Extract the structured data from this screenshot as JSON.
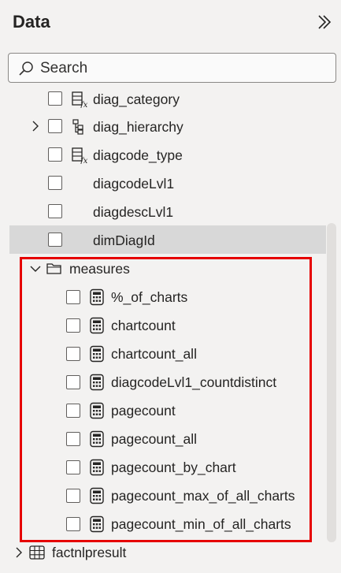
{
  "pane": {
    "title": "Data",
    "collapse_icon": "double-chevron-right-icon"
  },
  "search": {
    "placeholder": "Search",
    "icon": "search-icon"
  },
  "fields": [
    {
      "label": "diag_category",
      "icon": "calculated-column-icon"
    },
    {
      "label": "diag_hierarchy",
      "icon": "hierarchy-icon"
    },
    {
      "label": "diagcode_type",
      "icon": "calculated-column-icon"
    },
    {
      "label": "diagcodeLvl1",
      "icon": ""
    },
    {
      "label": "diagdescLvl1",
      "icon": ""
    },
    {
      "label": "dimDiagId",
      "icon": ""
    }
  ],
  "measures_folder": {
    "label": "measures",
    "icon": "folder-icon",
    "items": [
      {
        "label": "%_of_charts",
        "icon": "calculator-icon"
      },
      {
        "label": "chartcount",
        "icon": "calculator-icon"
      },
      {
        "label": "chartcount_all",
        "icon": "calculator-icon"
      },
      {
        "label": "diagcodeLvl1_countdistinct",
        "icon": "calculator-icon"
      },
      {
        "label": "pagecount",
        "icon": "calculator-icon"
      },
      {
        "label": "pagecount_all",
        "icon": "calculator-icon"
      },
      {
        "label": "pagecount_by_chart",
        "icon": "calculator-icon"
      },
      {
        "label": "pagecount_max_of_all_charts",
        "icon": "calculator-icon"
      },
      {
        "label": "pagecount_min_of_all_charts",
        "icon": "calculator-icon"
      }
    ]
  },
  "table": {
    "label": "factnlpresult",
    "icon": "table-icon"
  },
  "colors": {
    "highlight": "#e60000",
    "selected_row": "#d8d8d8",
    "background": "#f3f2f1"
  }
}
